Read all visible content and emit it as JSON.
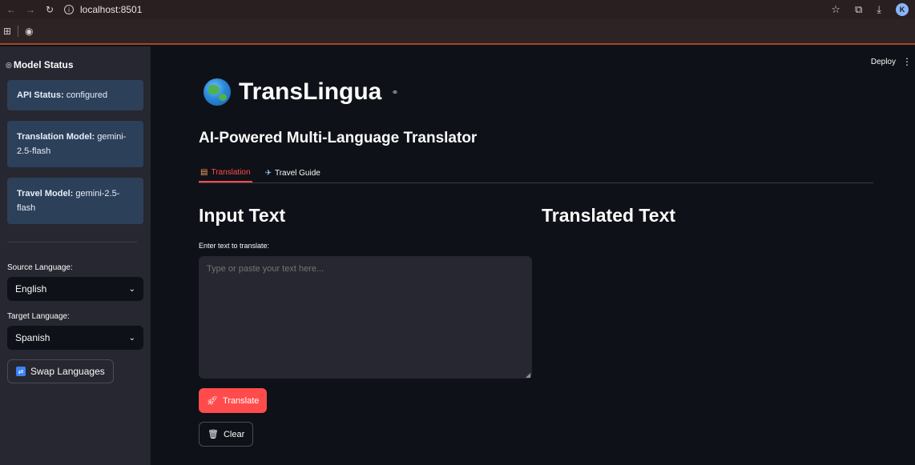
{
  "browser": {
    "url": "localhost:8501",
    "avatar_initial": "K"
  },
  "sidebar": {
    "title": "Model Status",
    "status_boxes": [
      {
        "key": "API Status:",
        "value": " configured"
      },
      {
        "key": "Translation Model:",
        "value": " gemini-2.5-flash"
      },
      {
        "key": "Travel Model:",
        "value": " gemini-2.5-flash"
      }
    ],
    "source_label": "Source Language:",
    "source_value": "English",
    "target_label": "Target Language:",
    "target_value": "Spanish",
    "swap_label": "Swap Languages"
  },
  "header": {
    "deploy_label": "Deploy",
    "menu_glyph": "⋮"
  },
  "main": {
    "title": "TransLingua",
    "subtitle": "AI-Powered Multi-Language Translator",
    "tabs": [
      {
        "label": "Translation",
        "active": true
      },
      {
        "label": "Travel Guide",
        "active": false
      }
    ],
    "input_heading": "Input Text",
    "output_heading": "Translated Text",
    "field_label": "Enter text to translate:",
    "placeholder": "Type or paste your text here...",
    "translate_label": "Translate",
    "clear_label": "Clear"
  },
  "colors": {
    "accent": "#ff4b4b",
    "sidebar_bg": "#262730",
    "main_bg": "#0e1117",
    "info_box": "#1e3a56"
  },
  "icons": {
    "back": "arrow-left-icon",
    "forward": "arrow-right-icon",
    "reload": "reload-icon",
    "star": "star-icon",
    "extensions": "puzzle-icon",
    "download": "download-icon",
    "apps": "apps-grid-icon",
    "globe_bookmark": "globe-icon",
    "link": "link-icon",
    "swap": "swap-icon",
    "translate": "rocket-icon",
    "clear": "trash-icon"
  }
}
